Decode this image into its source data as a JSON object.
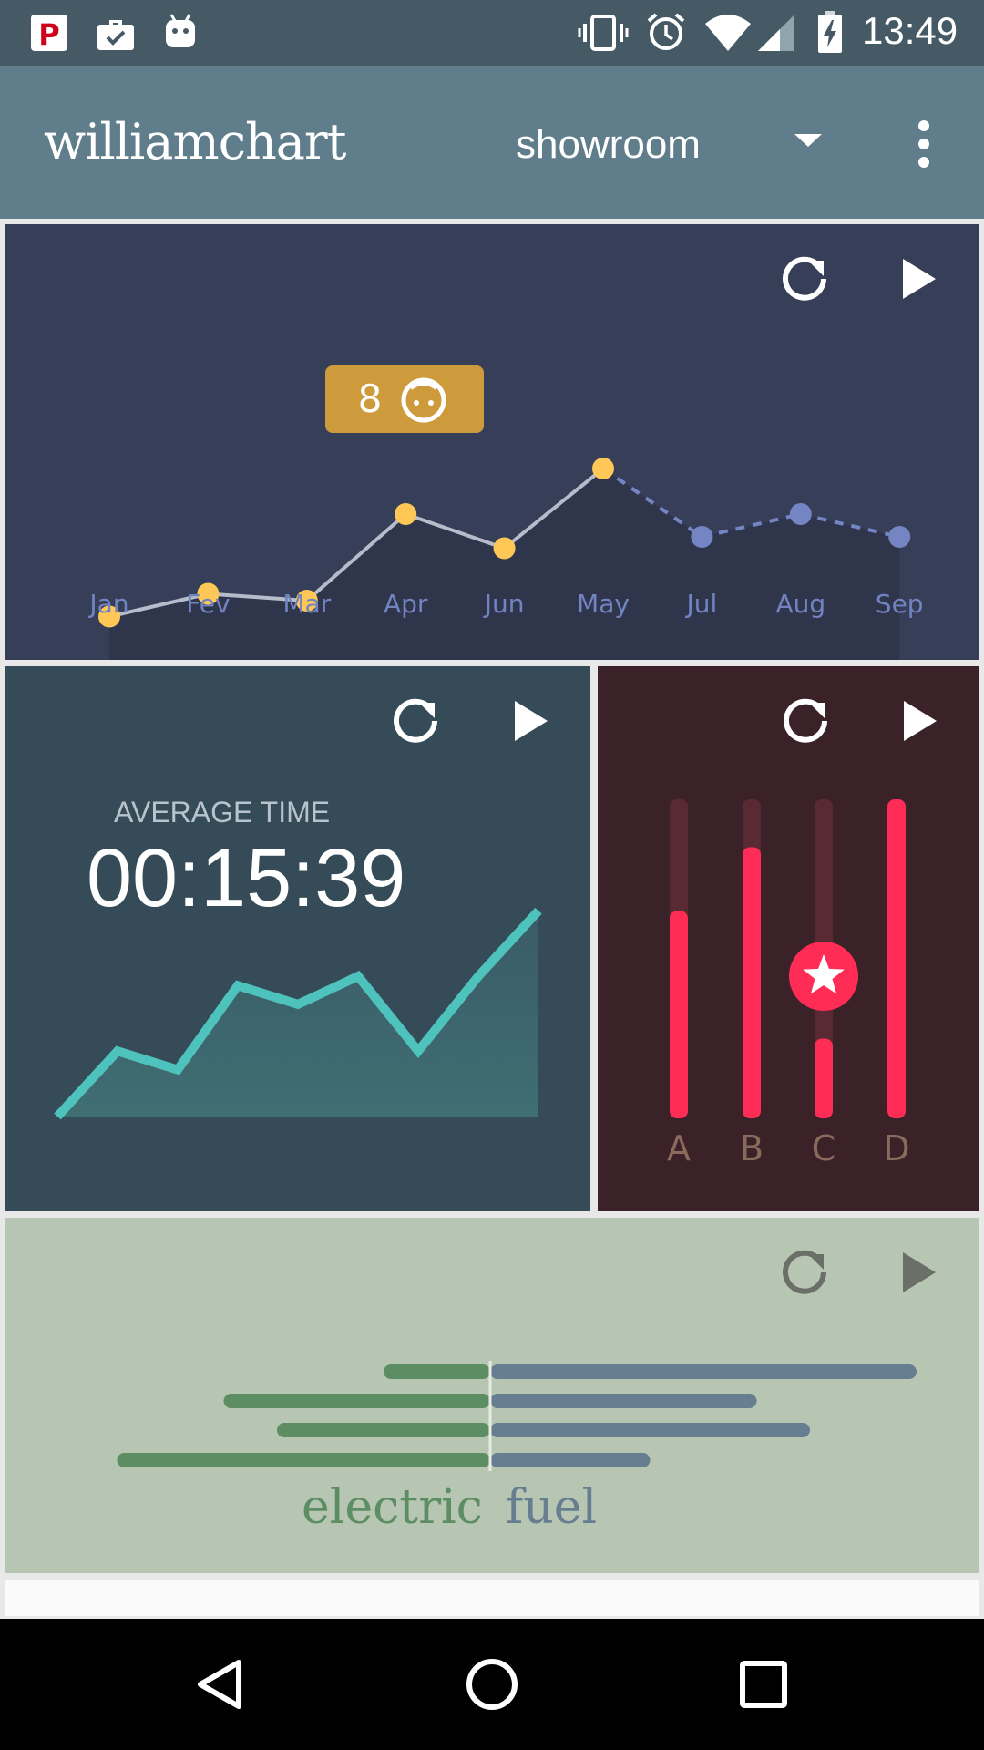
{
  "status_bar": {
    "time": "13:49",
    "left_icons": [
      "p-app-icon",
      "briefcase-check-icon",
      "android-icon"
    ],
    "right_icons": [
      "vibrate-icon",
      "alarm-icon",
      "wifi-icon",
      "signal-icon",
      "battery-charging-icon"
    ]
  },
  "app_bar": {
    "title": "williamchart",
    "spinner_value": "showroom",
    "icons": [
      "dropdown-arrow-icon",
      "overflow-menu-icon"
    ]
  },
  "colors": {
    "status_bar": "#455a64",
    "app_bar": "#607d8b",
    "line_card": "#363e58",
    "area_card": "#364b58",
    "bar_card": "#3a2228",
    "hbar_card": "#b7c6b2",
    "yellow": "#ffc755",
    "dash_blue": "#7585c4",
    "teal": "#4ec2bd",
    "red": "#ff2d55",
    "green": "#5c8d63",
    "slate": "#677e91"
  },
  "card_controls": [
    "refresh-icon",
    "play-icon"
  ],
  "charts": {
    "line": {
      "tooltip_value": "8",
      "tooltip_icon": "child-face-icon"
    },
    "area": {
      "label": "AVERAGE TIME",
      "value": "00:15:39"
    },
    "hbar": {
      "label_left": "electric",
      "label_right": "fuel"
    }
  },
  "chart_data": [
    {
      "type": "line",
      "categories": [
        "Jan",
        "Fev",
        "Mar",
        "Apr",
        "Jun",
        "May",
        "Jul",
        "Aug",
        "Sep"
      ],
      "series": [
        {
          "values": [
            3.5,
            4.5,
            4.2,
            8,
            6.5,
            10,
            null,
            null,
            null
          ],
          "color": "#ffc755"
        },
        {
          "values": [
            null,
            null,
            null,
            null,
            null,
            10,
            7,
            8,
            7
          ],
          "color": "#7585c4",
          "dashed": true
        }
      ],
      "ylim": [
        0,
        12
      ],
      "axis_line": false,
      "tooltip": {
        "category": "Apr",
        "value": 8
      }
    },
    {
      "type": "area",
      "x": [
        0,
        1,
        2,
        3,
        4,
        5,
        6,
        7,
        8
      ],
      "values": [
        0,
        3.5,
        2.5,
        7,
        6,
        7.5,
        3.5,
        7.5,
        11
      ],
      "ylim": [
        0,
        11.5
      ],
      "color": "#4ec2bd"
    },
    {
      "type": "bar",
      "categories": [
        "A",
        "B",
        "C",
        "D"
      ],
      "values": [
        6.5,
        8.5,
        2.5,
        10
      ],
      "ylim": [
        0,
        10
      ],
      "highlight": {
        "category": "C",
        "icon": "star-icon"
      },
      "color": "#ff2d55"
    },
    {
      "type": "bar",
      "orientation": "horizontal",
      "stacked_diverging": true,
      "series": [
        {
          "name": "electric",
          "values": [
            3,
            7.5,
            6,
            10.5
          ],
          "color": "#5c8d63"
        },
        {
          "name": "fuel",
          "values": [
            12,
            7.5,
            9,
            4.5
          ],
          "color": "#677e91"
        }
      ],
      "xlim": [
        -12,
        12.5
      ]
    }
  ]
}
